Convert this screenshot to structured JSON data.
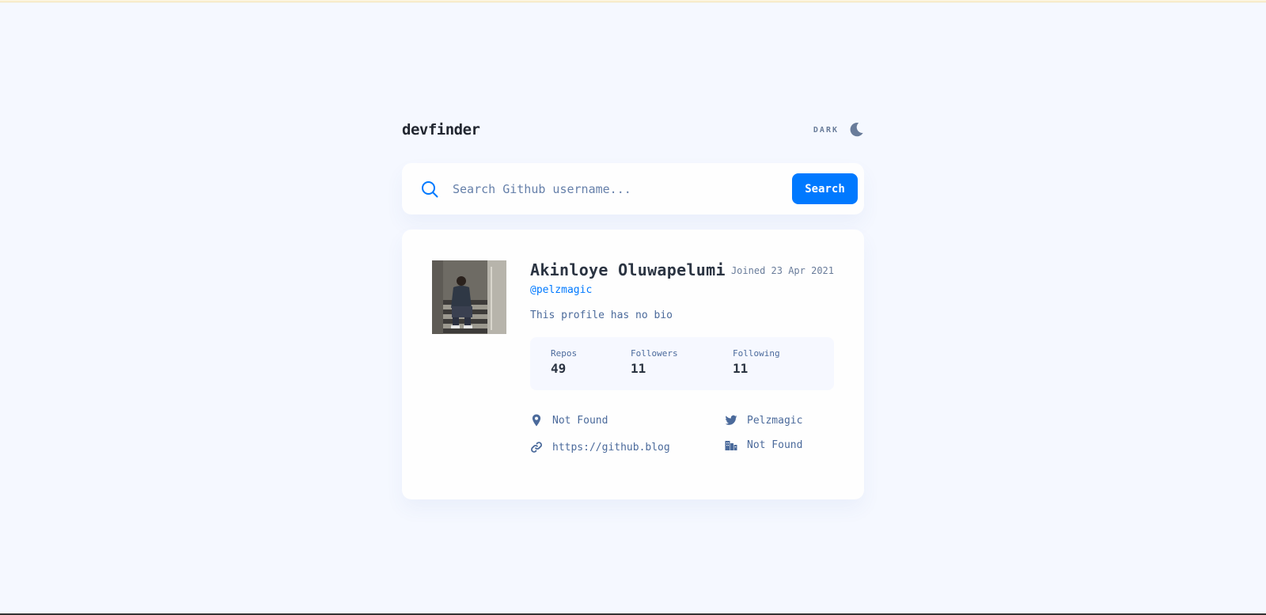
{
  "header": {
    "logo": "devfinder",
    "theme_label": "DARK"
  },
  "search": {
    "placeholder": "Search Github username...",
    "value": "",
    "button_label": "Search"
  },
  "profile": {
    "name": "Akinloye Oluwapelumi",
    "joined": "Joined 23 Apr 2021",
    "login": "@pelzmagic",
    "bio": "This profile has no bio",
    "stats": [
      {
        "label": "Repos",
        "value": "49"
      },
      {
        "label": "Followers",
        "value": "11"
      },
      {
        "label": "Following",
        "value": "11"
      }
    ],
    "links": {
      "location": "Not Found",
      "blog": "https://github.blog",
      "twitter": "Pelzmagic",
      "company": "Not Found"
    }
  },
  "colors": {
    "background": "#f5f8ff",
    "accent": "#0079ff",
    "text_dark": "#2b3442",
    "text_muted": "#4b6a9b",
    "card": "#fefefe"
  },
  "icons": {
    "search": "search-icon",
    "theme": "moon-icon",
    "location": "location-pin-icon",
    "blog": "link-icon",
    "twitter": "twitter-icon",
    "company": "building-icon"
  }
}
